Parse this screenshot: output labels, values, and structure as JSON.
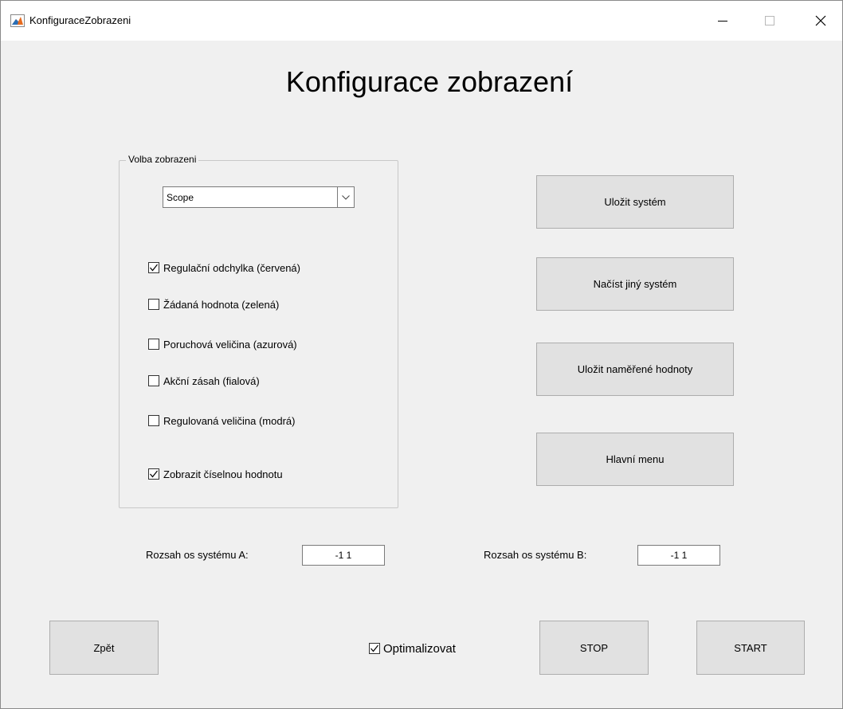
{
  "window": {
    "title": "KonfiguraceZobrazeni"
  },
  "page_title": "Konfigurace zobrazení",
  "display_group": {
    "legend": "Volba zobrazeni",
    "select_value": "Scope",
    "checkboxes": [
      {
        "label": "Regulační odchylka (červená)",
        "checked": true
      },
      {
        "label": "Žádaná hodnota (zelená)",
        "checked": false
      },
      {
        "label": "Poruchová veličina (azurová)",
        "checked": false
      },
      {
        "label": "Akční zásah (fialová)",
        "checked": false
      },
      {
        "label": "Regulovaná veličina (modrá)",
        "checked": false
      },
      {
        "label": "Zobrazit číselnou hodnotu",
        "checked": true
      }
    ]
  },
  "side_buttons": {
    "save_system": "Uložit systém",
    "load_system": "Načíst jiný systém",
    "save_measured": "Uložit naměřené hodnoty",
    "main_menu": "Hlavní menu"
  },
  "range": {
    "a_label": "Rozsah os systému A:",
    "a_value": "-1  1",
    "b_label": "Rozsah os systému B:",
    "b_value": "-1  1"
  },
  "bottom": {
    "back": "Zpět",
    "optimize_label": "Optimalizovat",
    "optimize_checked": true,
    "stop": "STOP",
    "start": "START"
  },
  "colors": {
    "accent_icon": "#e66b1f",
    "background": "#f0f0f0",
    "button_face": "#e1e1e1"
  }
}
